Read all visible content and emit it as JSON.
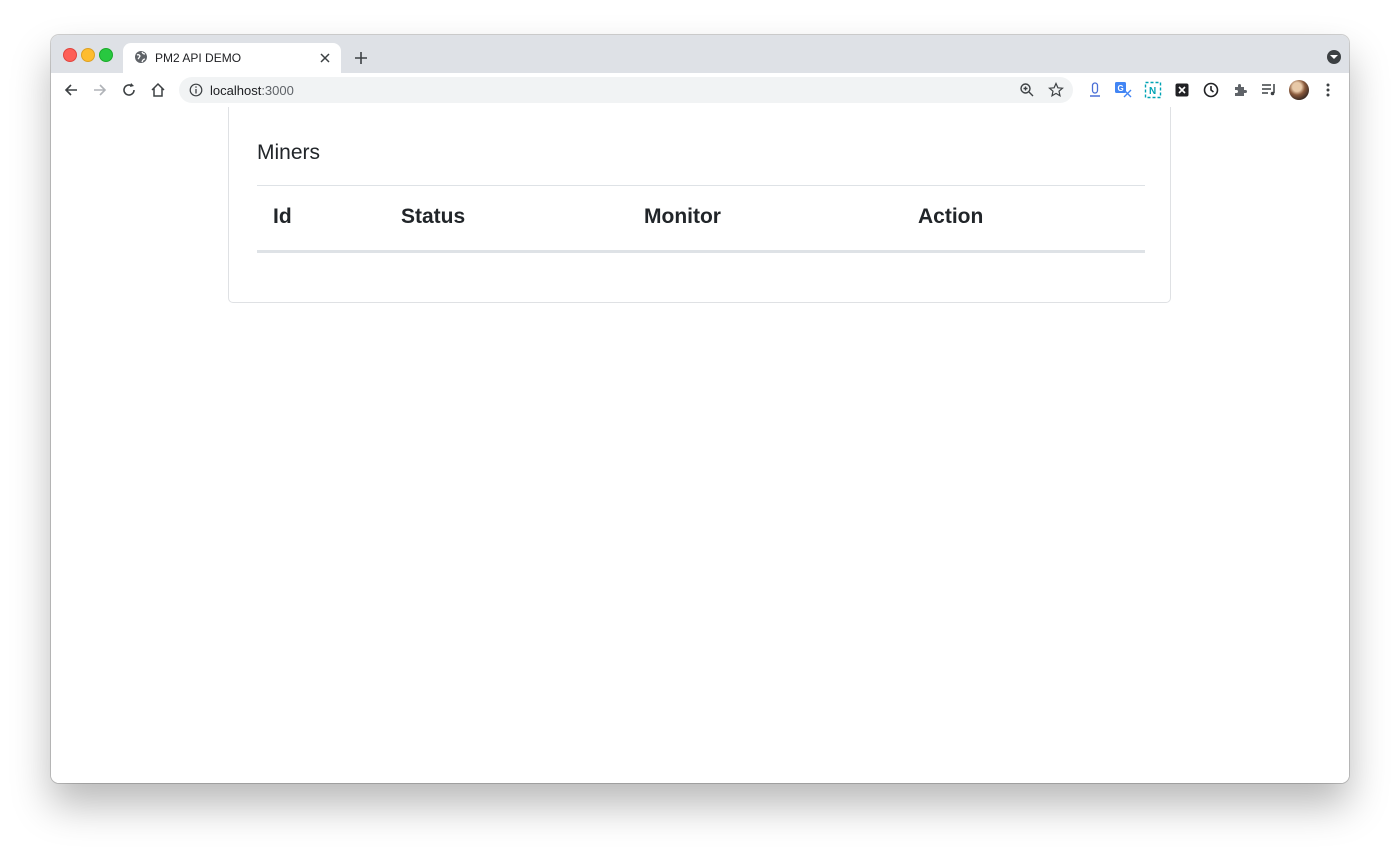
{
  "browser": {
    "tab_title": "PM2 API DEMO",
    "url_host": "localhost",
    "url_port": ":3000"
  },
  "icons": [
    "globe-icon",
    "close-icon",
    "plus-icon",
    "tab-search-icon",
    "back-icon",
    "forward-icon",
    "reload-icon",
    "home-icon",
    "info-icon",
    "zoom-icon",
    "star-icon",
    "extension-icon",
    "translate-icon",
    "notion-icon",
    "x-extension-icon",
    "clock-icon",
    "puzzle-icon",
    "media-icon",
    "menu-icon"
  ],
  "card": {
    "title": "Miners",
    "columns": [
      "Id",
      "Status",
      "Monitor",
      "Action"
    ]
  }
}
